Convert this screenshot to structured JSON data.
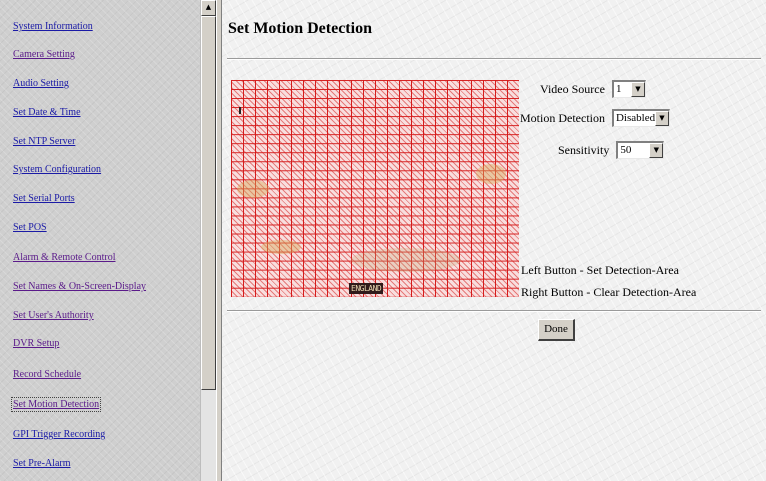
{
  "nav": {
    "items": [
      {
        "label": "System Information"
      },
      {
        "label": "Camera Setting"
      },
      {
        "label": "Audio Setting"
      },
      {
        "label": "Set Date & Time"
      },
      {
        "label": "Set NTP Server"
      },
      {
        "label": "System Configuration"
      },
      {
        "label": "Set Serial Ports"
      },
      {
        "label": "Set POS"
      },
      {
        "label": "Alarm & Remote Control"
      },
      {
        "label": "Set Names & On-Screen-Display"
      },
      {
        "label": "Set User's Authority"
      },
      {
        "label": "DVR Setup"
      },
      {
        "label": "Record Schedule"
      },
      {
        "label": "Set Motion Detection"
      },
      {
        "label": "GPI Trigger Recording"
      },
      {
        "label": "Set Pre-Alarm"
      }
    ],
    "active_label": "Set Motion Detection"
  },
  "main": {
    "title": "Set Motion Detection",
    "preview": {
      "osd_text": "ENGLAND"
    },
    "controls": {
      "video_source": {
        "label": "Video Source",
        "value": "1"
      },
      "motion_detection": {
        "label": "Motion Detection",
        "value": "Disabled"
      },
      "sensitivity": {
        "label": "Sensitivity",
        "value": "50"
      }
    },
    "instructions": {
      "left": "Left Button - Set Detection-Area",
      "right": "Right Button - Clear Detection-Area"
    },
    "done_label": "Done"
  },
  "colors": {
    "grid_line": "#d51c1c",
    "link": "#1a1aa6",
    "visited_link": "#5a1a8a",
    "nav_background": "#cfcfcf",
    "main_background": "#f1f1f1"
  },
  "icons": {
    "scroll_up": "up-arrow-icon",
    "dropdown": "chevron-down-icon"
  }
}
